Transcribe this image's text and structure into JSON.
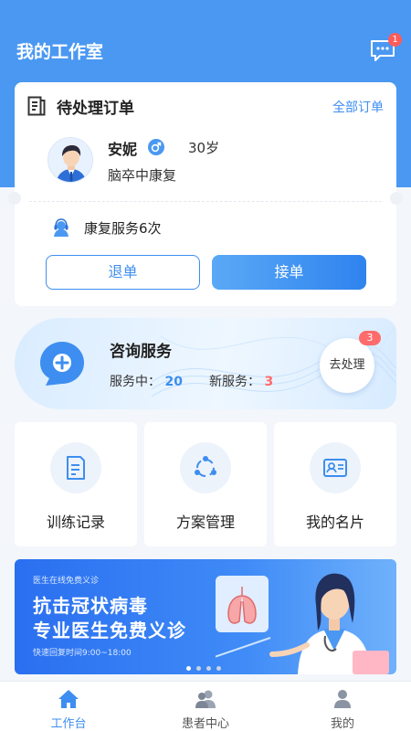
{
  "header": {
    "title": "我的工作室",
    "message_badge": "1"
  },
  "pending_order": {
    "title": "待处理订单",
    "all_orders_link": "全部订单",
    "patient": {
      "name": "安妮",
      "gender": "male",
      "age": "30岁",
      "diagnosis": "脑卒中康复"
    },
    "service": "康复服务6次",
    "reject_label": "退单",
    "accept_label": "接单"
  },
  "consult": {
    "title": "咨询服务",
    "serving_label": "服务中：",
    "serving_count": "20",
    "new_label": "新服务：",
    "new_count": "3",
    "action_label": "去处理",
    "action_badge": "3"
  },
  "tiles": [
    {
      "label": "训练记录",
      "icon": "training-record-icon"
    },
    {
      "label": "方案管理",
      "icon": "plan-management-icon"
    },
    {
      "label": "我的名片",
      "icon": "business-card-icon"
    }
  ],
  "banner": {
    "tagline": "医生在线免费义诊",
    "line1": "抗击冠状病毒",
    "line2": "专业医生免费义诊",
    "hours": "快速回复时间9:00~18:00",
    "active_slide": 0,
    "slide_count": 4
  },
  "tabbar": [
    {
      "label": "工作台",
      "icon": "home-icon",
      "active": true
    },
    {
      "label": "患者中心",
      "icon": "patients-icon",
      "active": false
    },
    {
      "label": "我的",
      "icon": "profile-icon",
      "active": false
    }
  ],
  "colors": {
    "primary": "#4a98f2",
    "accent": "#3d8ef0",
    "badge": "#ff5a5a",
    "background": "#f3f6fa"
  }
}
